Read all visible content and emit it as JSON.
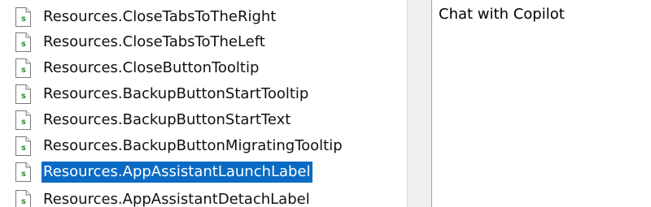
{
  "tree": {
    "items": [
      {
        "label": "Resources.CloseTabsToTheRight",
        "selected": false
      },
      {
        "label": "Resources.CloseTabsToTheLeft",
        "selected": false
      },
      {
        "label": "Resources.CloseButtonTooltip",
        "selected": false
      },
      {
        "label": "Resources.BackupButtonStartTooltip",
        "selected": false
      },
      {
        "label": "Resources.BackupButtonStartText",
        "selected": false
      },
      {
        "label": "Resources.BackupButtonMigratingTooltip",
        "selected": false
      },
      {
        "label": "Resources.AppAssistantLaunchLabel",
        "selected": true
      },
      {
        "label": "Resources.AppAssistantDetachLabel",
        "selected": false
      }
    ],
    "icon": "string-resource-file-icon"
  },
  "detail": {
    "value": "Chat with Copilot"
  },
  "colors": {
    "selection": "#0a6bc4",
    "selection_text": "#ffffff",
    "icon_accent": "#2e8b3a"
  }
}
